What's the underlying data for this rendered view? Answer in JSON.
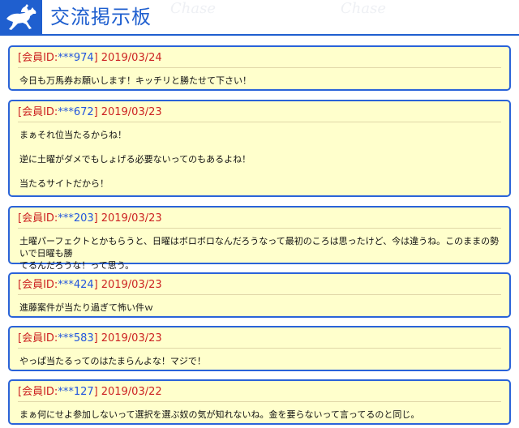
{
  "header": {
    "title": "交流掲示板",
    "logo_icon": "horse-jockey-icon",
    "watermark": "Chase"
  },
  "colors": {
    "accent": "#1f5fcf",
    "post_background": "#ffffcc",
    "post_border": "#2a63d9",
    "label_red": "#cc2222",
    "id_blue": "#2255dd"
  },
  "posts": [
    {
      "label": "会員ID:",
      "member_id": "***974",
      "date": "2019/03/24",
      "lines": [
        "今日も万馬券お願いします！キッチリと勝たせて下さい！"
      ]
    },
    {
      "label": "会員ID:",
      "member_id": "***672",
      "date": "2019/03/23",
      "lines": [
        "まぁそれ位当たるからね！",
        "逆に土曜がダメでもしょげる必要ないってのもあるよね！",
        "当たるサイトだから！"
      ]
    },
    {
      "label": "会員ID:",
      "member_id": "***203",
      "date": "2019/03/23",
      "lines": [
        "土曜パーフェクトとかもらうと、日曜はボロボロなんだろうなって最初のころは思ったけど、今は違うね。このままの勢いで日曜も勝",
        "てるんだろうな！って思う。"
      ]
    },
    {
      "label": "会員ID:",
      "member_id": "***424",
      "date": "2019/03/23",
      "lines": [
        "進藤案件が当たり過ぎて怖い件ｗ"
      ]
    },
    {
      "label": "会員ID:",
      "member_id": "***583",
      "date": "2019/03/23",
      "lines": [
        "やっぱ当たるってのはたまらんよな！マジで！"
      ]
    },
    {
      "label": "会員ID:",
      "member_id": "***127",
      "date": "2019/03/22",
      "lines": [
        "まぁ何にせよ参加しないって選択を選ぶ奴の気が知れないね。金を要らないって言ってるのと同じ。"
      ]
    }
  ]
}
